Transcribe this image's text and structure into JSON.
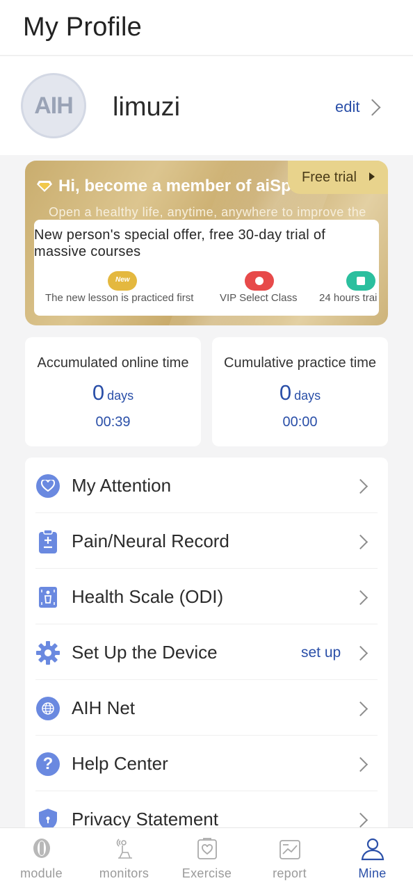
{
  "header": {
    "title": "My Profile"
  },
  "profile": {
    "avatar_text": "AIH",
    "username": "limuzi",
    "edit_label": "edit"
  },
  "banner": {
    "title": "Hi, become a member of aiSpine",
    "trial_label": "Free trial",
    "subtitle": "Open a healthy life, anytime, anywhere to improve the",
    "offer": "New person's special offer, free 30-day trial of massive courses",
    "perks": [
      {
        "label": "The new lesson is practiced first",
        "badge": "New"
      },
      {
        "label": "VIP Select Class"
      },
      {
        "label": "24 hours trai"
      }
    ]
  },
  "stats": [
    {
      "label": "Accumulated online time",
      "days": "0",
      "unit": "days",
      "time": "00:39"
    },
    {
      "label": "Cumulative practice time",
      "days": "0",
      "unit": "days",
      "time": "00:00"
    }
  ],
  "menu": {
    "items": [
      {
        "label": "My Attention",
        "icon": "heart-icon"
      },
      {
        "label": "Pain/Neural Record",
        "icon": "clipboard-icon"
      },
      {
        "label": "Health Scale (ODI)",
        "icon": "body-scale-icon"
      },
      {
        "label": "Set Up the Device",
        "icon": "gear-icon",
        "extra": "set up"
      },
      {
        "label": "AIH Net",
        "icon": "globe-icon"
      },
      {
        "label": "Help Center",
        "icon": "question-icon"
      },
      {
        "label": "Privacy Statement",
        "icon": "shield-icon"
      }
    ]
  },
  "tabbar": {
    "tabs": [
      {
        "label": "module",
        "icon": "module-icon"
      },
      {
        "label": "monitors",
        "icon": "monitor-icon"
      },
      {
        "label": "Exercise",
        "icon": "exercise-icon"
      },
      {
        "label": "report",
        "icon": "report-icon"
      },
      {
        "label": "Mine",
        "icon": "user-icon",
        "active": true
      }
    ]
  },
  "colors": {
    "accent": "#2a4fa8",
    "icon_blue": "#6a89e0",
    "gold": "#c9ad6e"
  }
}
